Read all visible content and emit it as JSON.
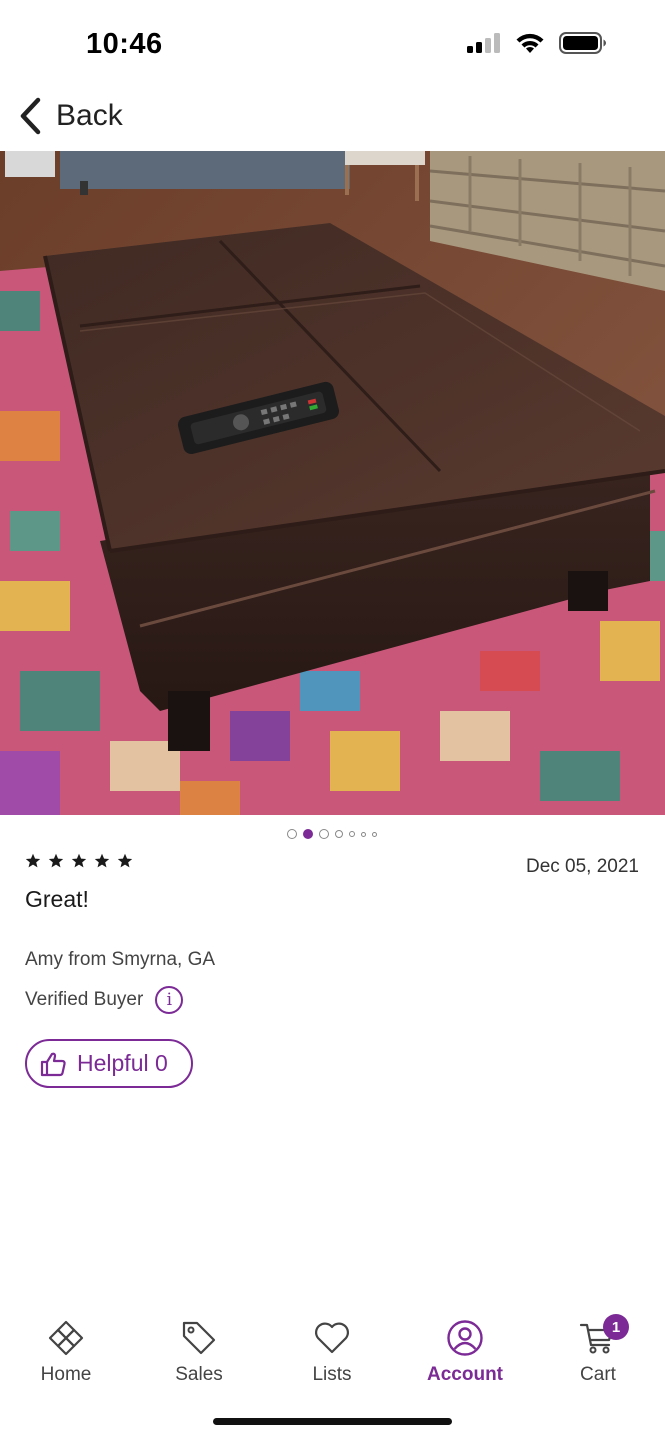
{
  "status_bar": {
    "time": "10:46",
    "icons": [
      "cellular-signal-icon",
      "wifi-icon",
      "battery-icon"
    ]
  },
  "nav": {
    "back_label": "Back",
    "icon": "chevron-left-icon"
  },
  "photo": {
    "description_icon": "product-photo"
  },
  "carousel": {
    "total": 7,
    "active_index": 1
  },
  "review": {
    "rating": 5,
    "date": "Dec 05, 2021",
    "title": "Great!",
    "reviewer": "Amy from Smyrna, GA",
    "verified_label": "Verified Buyer",
    "info_glyph": "i",
    "helpful_label": "Helpful 0"
  },
  "tabs": [
    {
      "label": "Home",
      "icon": "home-icon",
      "active": false
    },
    {
      "label": "Sales",
      "icon": "tag-icon",
      "active": false
    },
    {
      "label": "Lists",
      "icon": "heart-icon",
      "active": false
    },
    {
      "label": "Account",
      "icon": "account-icon",
      "active": true
    },
    {
      "label": "Cart",
      "icon": "cart-icon",
      "active": false,
      "badge": "1"
    }
  ],
  "colors": {
    "accent": "#7b2a96",
    "text": "#222222",
    "background": "#ffffff"
  }
}
